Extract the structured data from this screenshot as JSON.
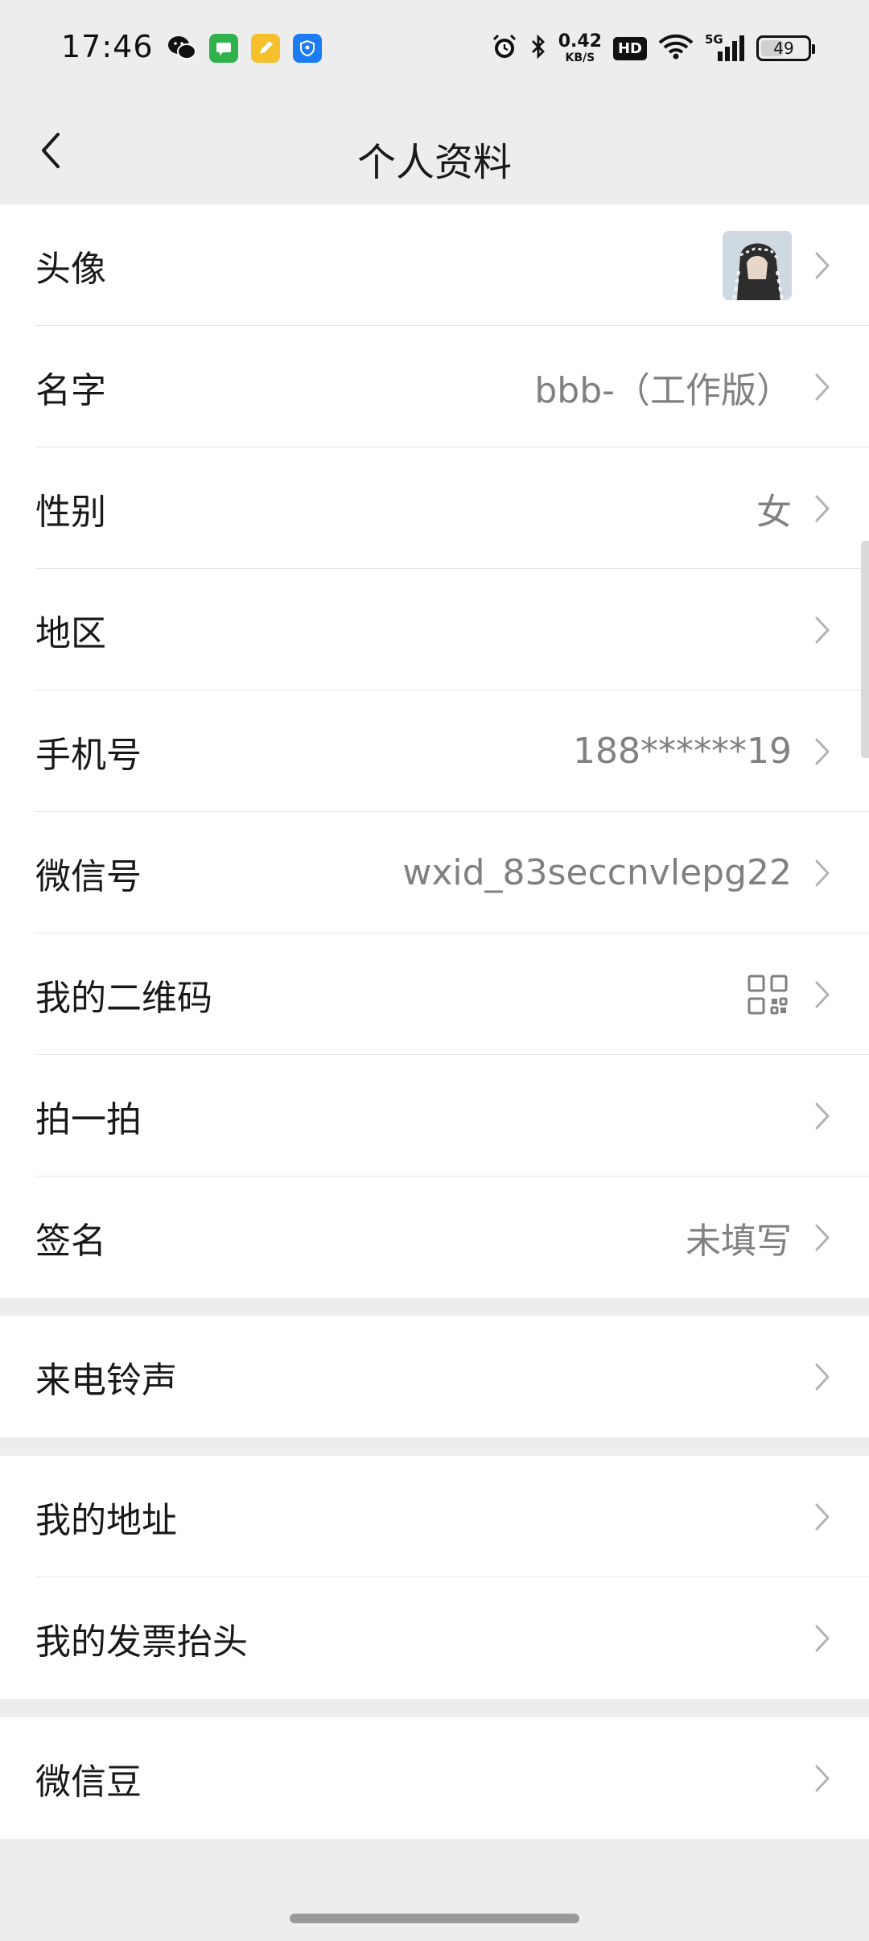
{
  "status_bar": {
    "time": "17:46",
    "net_speed_value": "0.42",
    "net_speed_unit": "KB/S",
    "hd_label": "HD",
    "network_label": "5G",
    "battery_level": "49",
    "notification_icons": [
      "wechat-icon",
      "messages-icon",
      "notes-icon",
      "shield-icon"
    ],
    "system_icons": [
      "alarm-icon",
      "bluetooth-icon",
      "wifi-icon",
      "signal-icon",
      "battery-icon"
    ]
  },
  "nav": {
    "title": "个人资料",
    "back_icon": "chevron-left-icon"
  },
  "profile_group": [
    {
      "label": "头像",
      "value": "",
      "type": "avatar"
    },
    {
      "label": "名字",
      "value": "bbb-（工作版）"
    },
    {
      "label": "性别",
      "value": "女"
    },
    {
      "label": "地区",
      "value": ""
    },
    {
      "label": "手机号",
      "value": "188******19"
    },
    {
      "label": "微信号",
      "value": "wxid_83seccnvlepg22"
    },
    {
      "label": "我的二维码",
      "value": "",
      "type": "qr-code-icon"
    },
    {
      "label": "拍一拍",
      "value": ""
    },
    {
      "label": "签名",
      "value": "未填写"
    }
  ],
  "ringtone_group": [
    {
      "label": "来电铃声",
      "value": ""
    }
  ],
  "address_group": [
    {
      "label": "我的地址",
      "value": ""
    },
    {
      "label": "我的发票抬头",
      "value": ""
    }
  ],
  "beans_group": [
    {
      "label": "微信豆",
      "value": ""
    }
  ],
  "colors": {
    "background": "#ededed",
    "card": "#ffffff",
    "text_primary": "#191919",
    "text_secondary": "#808080",
    "divider": "#e5e5e5",
    "chevron": "#b2b2b2"
  }
}
